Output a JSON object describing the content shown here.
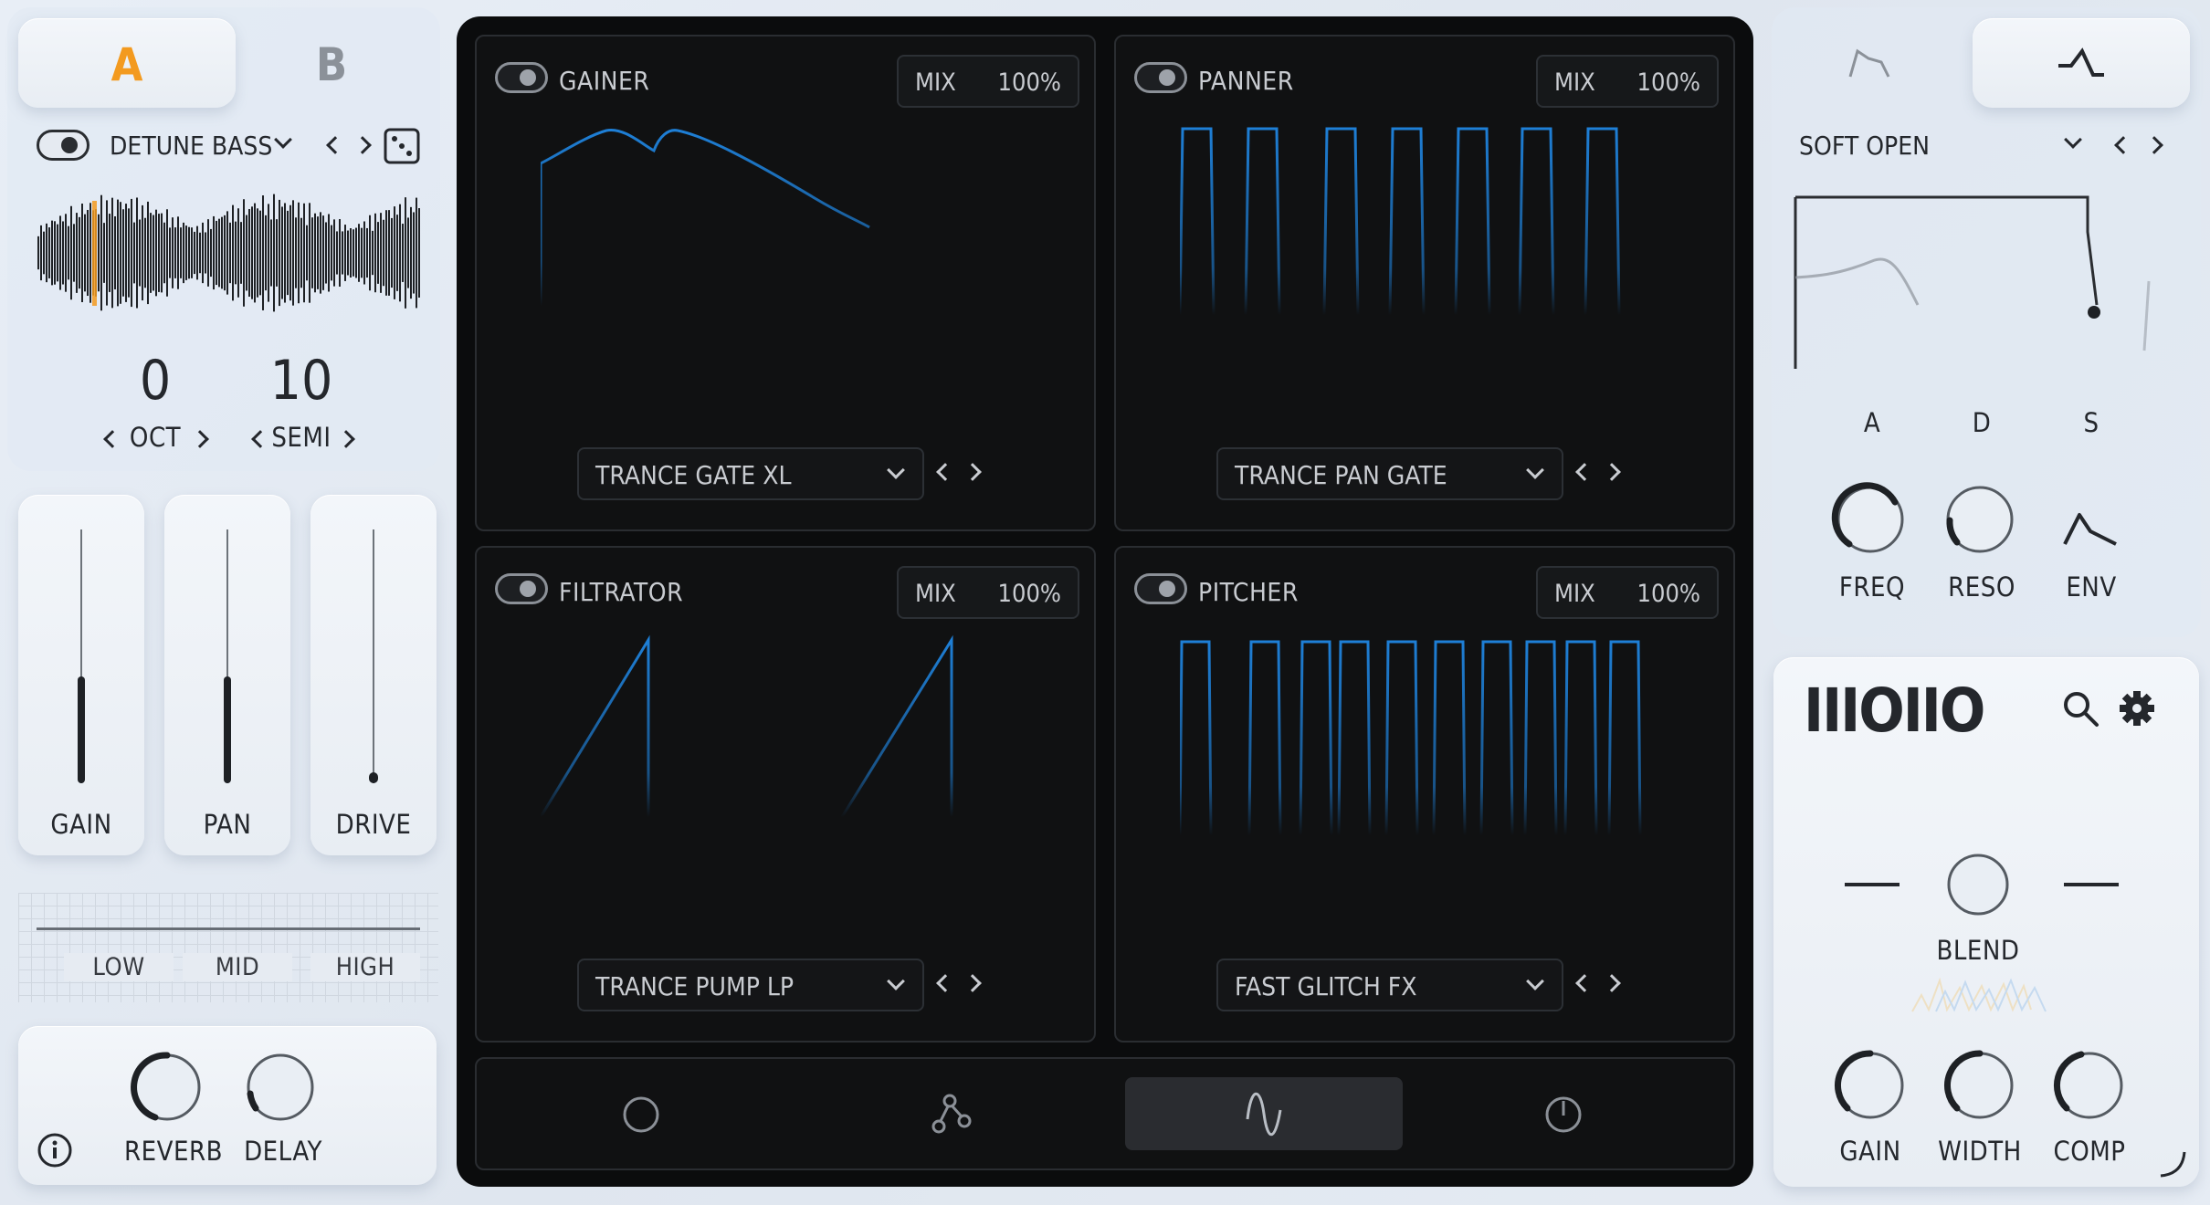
{
  "left": {
    "ab": {
      "a_label": "A",
      "b_label": "B",
      "active": "A"
    },
    "sample": {
      "name": "DETUNE BASS",
      "enabled": true
    },
    "tuning": {
      "oct_value": "0",
      "oct_label": "OCT",
      "semi_value": "10",
      "semi_label": "SEMI"
    },
    "faders": [
      {
        "label": "GAIN",
        "level": 0.42
      },
      {
        "label": "PAN",
        "level": 0.42
      },
      {
        "label": "DRIVE",
        "level": 0.02
      }
    ],
    "eq": {
      "low": "LOW",
      "mid": "MID",
      "high": "HIGH"
    },
    "fx": {
      "reverb": "REVERB",
      "delay": "DELAY"
    }
  },
  "center": {
    "modules": [
      {
        "title": "GAINER",
        "mix_label": "MIX",
        "mix_value": "100%",
        "preset": "TRANCE GATE XL"
      },
      {
        "title": "PANNER",
        "mix_label": "MIX",
        "mix_value": "100%",
        "preset": "TRANCE PAN GATE"
      },
      {
        "title": "FILTRATOR",
        "mix_label": "MIX",
        "mix_value": "100%",
        "preset": "TRANCE PUMP LP"
      },
      {
        "title": "PITCHER",
        "mix_label": "MIX",
        "mix_value": "100%",
        "preset": "FAST GLITCH FX"
      }
    ],
    "bottom_tabs": [
      "circle-icon",
      "nodes-icon",
      "wave-icon",
      "power-icon"
    ],
    "active_tab": 2,
    "accent": "#1e7fd6"
  },
  "right": {
    "filter": {
      "preset": "SOFT OPEN",
      "adsr_labels": [
        "A",
        "D",
        "S"
      ],
      "knobs": [
        "FREQ",
        "RESO",
        "ENV"
      ]
    },
    "brand": {
      "logo": "IIIOIIO"
    },
    "master": {
      "blend": "BLEND",
      "knobs": [
        "GAIN",
        "WIDTH",
        "COMP"
      ]
    }
  },
  "colors": {
    "accent_orange": "#f39a1f",
    "accent_blue": "#1e7fd6"
  }
}
